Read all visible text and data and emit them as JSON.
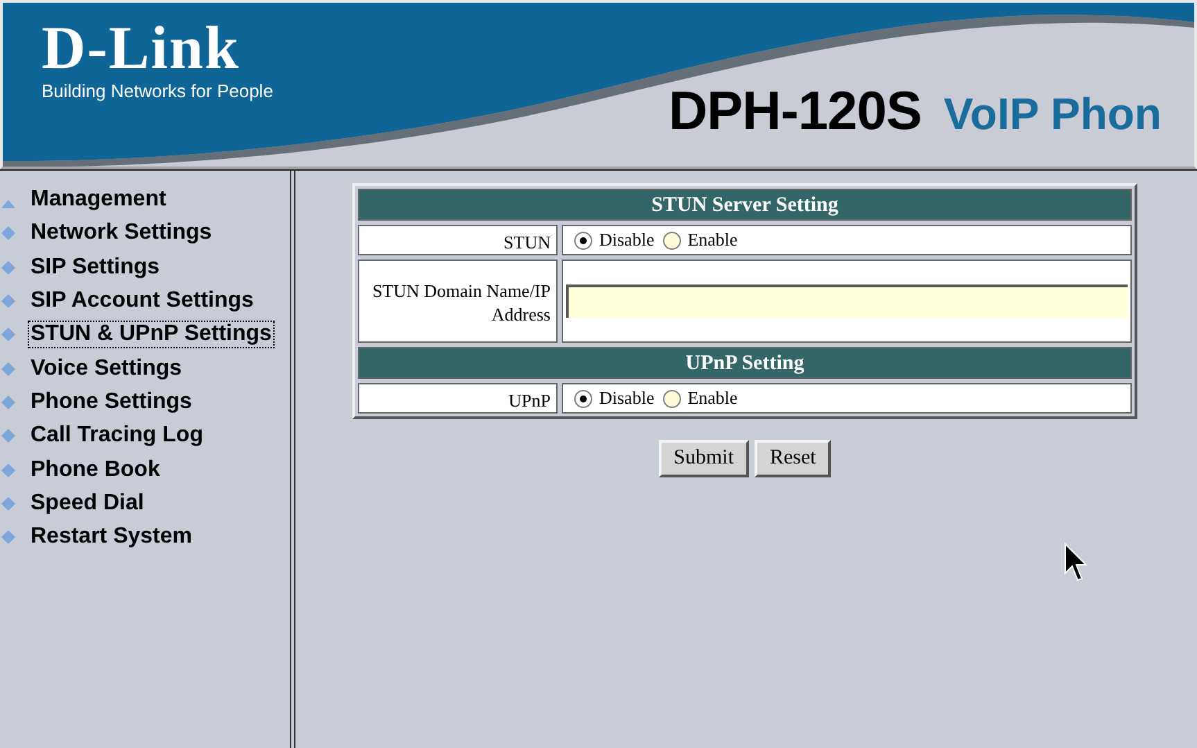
{
  "header": {
    "logo": "D-Link",
    "tagline": "Building Networks for People",
    "model": "DPH-120S",
    "product": "VoIP Phon"
  },
  "sidebar": {
    "items": [
      {
        "label": "Management",
        "selected": false,
        "kind": "top"
      },
      {
        "label": "Network Settings",
        "selected": false,
        "kind": "item"
      },
      {
        "label": "SIP Settings",
        "selected": false,
        "kind": "item"
      },
      {
        "label": "SIP Account Settings",
        "selected": false,
        "kind": "item"
      },
      {
        "label": "STUN & UPnP Settings",
        "selected": true,
        "kind": "item"
      },
      {
        "label": "Voice Settings",
        "selected": false,
        "kind": "item"
      },
      {
        "label": "Phone Settings",
        "selected": false,
        "kind": "item"
      },
      {
        "label": "Call Tracing Log",
        "selected": false,
        "kind": "item"
      },
      {
        "label": "Phone Book",
        "selected": false,
        "kind": "item"
      },
      {
        "label": "Speed Dial",
        "selected": false,
        "kind": "item"
      },
      {
        "label": "Restart System",
        "selected": false,
        "kind": "item"
      }
    ]
  },
  "sections": [
    {
      "title": "STUN Server Setting",
      "rows": [
        {
          "kind": "radio",
          "label": "STUN",
          "options": [
            {
              "label": "Disable",
              "selected": true
            },
            {
              "label": "Enable",
              "selected": false
            }
          ]
        },
        {
          "kind": "text",
          "label": "STUN Domain Name/IP Address"
        }
      ]
    },
    {
      "title": "UPnP Setting",
      "rows": [
        {
          "kind": "radio",
          "label": "UPnP",
          "options": [
            {
              "label": "Disable",
              "selected": true
            },
            {
              "label": "Enable",
              "selected": false
            }
          ]
        }
      ]
    }
  ],
  "buttons": [
    "Submit",
    "Reset"
  ]
}
